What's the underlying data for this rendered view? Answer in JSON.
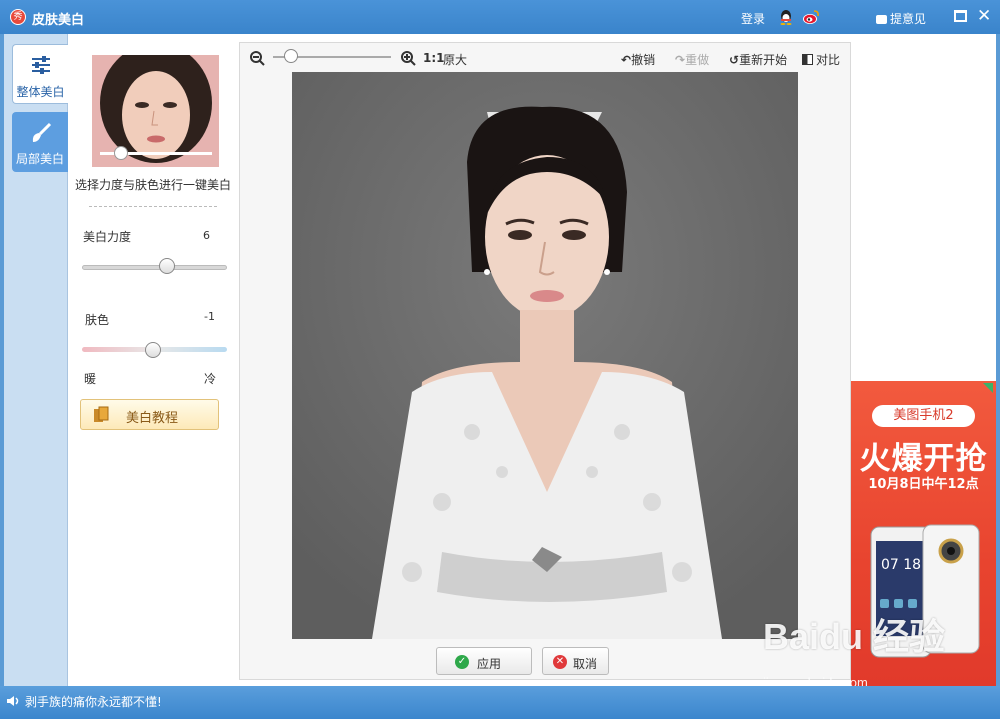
{
  "titlebar": {
    "title": "皮肤美白",
    "login": "登录",
    "feedback": "提意见"
  },
  "tabs": [
    {
      "label": "整体美白",
      "icon": "sliders-icon",
      "active": true
    },
    {
      "label": "局部美白",
      "icon": "brush-icon",
      "active": false
    }
  ],
  "panel": {
    "caption": "选择力度与肤色进行一键美白",
    "strength": {
      "label": "美白力度",
      "value": "6"
    },
    "tone": {
      "label": "肤色",
      "value": "-1",
      "left_label": "暖",
      "right_label": "冷"
    },
    "tutorial_label": "美白教程"
  },
  "toolbar": {
    "zoom_label": "1:1",
    "original_label": "原大",
    "undo": "撤销",
    "redo": "重做",
    "restart": "重新开始",
    "compare": "对比"
  },
  "actions": {
    "apply": "应用",
    "cancel": "取消"
  },
  "ad": {
    "pill": "美图手机2",
    "headline": "火爆开抢",
    "date": "10月8日中午12点",
    "phone_time": "07 18"
  },
  "watermark": {
    "text": "Baidu 经验",
    "url": "jingyan.baidu.com"
  },
  "status": {
    "text": "剥手族的痛你永远都不懂!"
  },
  "colors": {
    "titlebar": "#3a84cb",
    "accent": "#5d9ee0",
    "apply": "#2ea84a",
    "cancel": "#e0393b",
    "ad": "#e8442f"
  }
}
